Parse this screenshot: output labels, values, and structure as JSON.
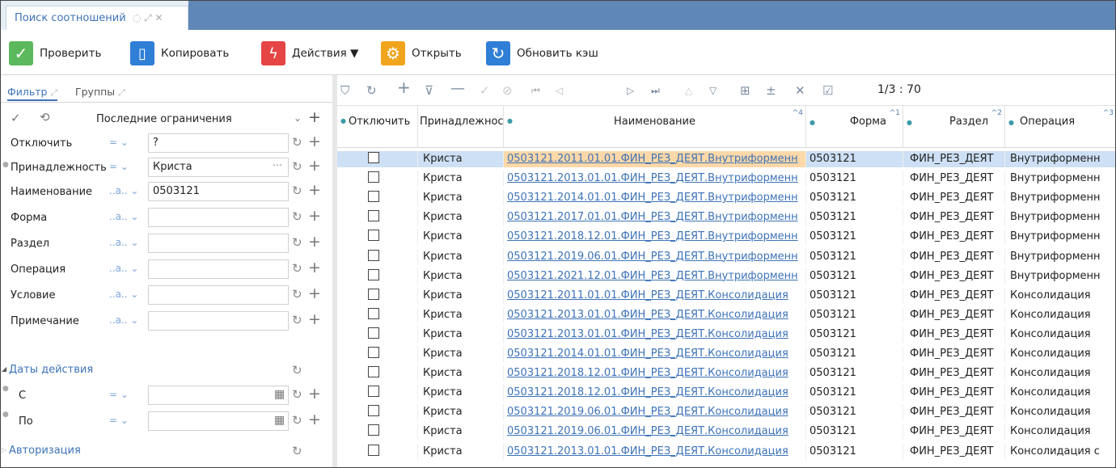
{
  "window": {
    "tab_title": "Поиск соотношений"
  },
  "toolbar": {
    "check_label": "Проверить",
    "copy_label": "Копировать",
    "actions_label": "Действия ▼",
    "open_label": "Открыть",
    "refresh_cache_label": "Обновить кэш"
  },
  "filter_panel": {
    "tab_filter": "Фильтр",
    "tab_groups": "Группы",
    "preset_value": "Последние ограничения",
    "fields": [
      {
        "label": "Отключить",
        "operator": "= ⌄",
        "value": "?"
      },
      {
        "label": "Принадлежность",
        "operator": "= ⌄",
        "value": "Криста"
      },
      {
        "label": "Наименование",
        "operator": "..a.. ⌄",
        "value": "0503121"
      },
      {
        "label": "Форма",
        "operator": "..a.. ⌄",
        "value": ""
      },
      {
        "label": "Раздел",
        "operator": "..a.. ⌄",
        "value": ""
      },
      {
        "label": "Операция",
        "operator": "..a.. ⌄",
        "value": ""
      },
      {
        "label": "Условие",
        "operator": "..a.. ⌄",
        "value": ""
      },
      {
        "label": "Примечание",
        "operator": "..a.. ⌄",
        "value": ""
      }
    ],
    "dates_section": "Даты действия",
    "date_from_label": "С",
    "date_to_label": "По",
    "date_operator": "= ⌄",
    "auth_section": "Авторизация"
  },
  "grid": {
    "pager": "1/3 : 70",
    "columns": [
      "Отключить",
      "Принадлежность",
      "Наименование",
      "Форма",
      "Раздел",
      "Операция"
    ],
    "rows": [
      {
        "owner": "Криста",
        "name": "0503121.2011.01.01.ФИН_РЕЗ_ДЕЯТ.Внутриформенн",
        "form": "0503121",
        "section": "ФИН_РЕЗ_ДЕЯТ",
        "operation": "Внутриформенн"
      },
      {
        "owner": "Криста",
        "name": "0503121.2013.01.01.ФИН_РЕЗ_ДЕЯТ.Внутриформенн",
        "form": "0503121",
        "section": "ФИН_РЕЗ_ДЕЯТ",
        "operation": "Внутриформенн"
      },
      {
        "owner": "Криста",
        "name": "0503121.2014.01.01.ФИН_РЕЗ_ДЕЯТ.Внутриформенн",
        "form": "0503121",
        "section": "ФИН_РЕЗ_ДЕЯТ",
        "operation": "Внутриформенн"
      },
      {
        "owner": "Криста",
        "name": "0503121.2017.01.01.ФИН_РЕЗ_ДЕЯТ.Внутриформенн",
        "form": "0503121",
        "section": "ФИН_РЕЗ_ДЕЯТ",
        "operation": "Внутриформенн"
      },
      {
        "owner": "Криста",
        "name": "0503121.2018.12.01.ФИН_РЕЗ_ДЕЯТ.Внутриформенн",
        "form": "0503121",
        "section": "ФИН_РЕЗ_ДЕЯТ",
        "operation": "Внутриформенн"
      },
      {
        "owner": "Криста",
        "name": "0503121.2019.06.01.ФИН_РЕЗ_ДЕЯТ.Внутриформенн",
        "form": "0503121",
        "section": "ФИН_РЕЗ_ДЕЯТ",
        "operation": "Внутриформенн"
      },
      {
        "owner": "Криста",
        "name": "0503121.2021.12.01.ФИН_РЕЗ_ДЕЯТ.Внутриформенн",
        "form": "0503121",
        "section": "ФИН_РЕЗ_ДЕЯТ",
        "operation": "Внутриформенн"
      },
      {
        "owner": "Криста",
        "name": "0503121.2011.01.01.ФИН_РЕЗ_ДЕЯТ.Консолидация",
        "form": "0503121",
        "section": "ФИН_РЕЗ_ДЕЯТ",
        "operation": "Консолидация"
      },
      {
        "owner": "Криста",
        "name": "0503121.2013.01.01.ФИН_РЕЗ_ДЕЯТ.Консолидация",
        "form": "0503121",
        "section": "ФИН_РЕЗ_ДЕЯТ",
        "operation": "Консолидация"
      },
      {
        "owner": "Криста",
        "name": "0503121.2013.01.01.ФИН_РЕЗ_ДЕЯТ.Консолидация",
        "form": "0503121",
        "section": "ФИН_РЕЗ_ДЕЯТ",
        "operation": "Консолидация"
      },
      {
        "owner": "Криста",
        "name": "0503121.2014.01.01.ФИН_РЕЗ_ДЕЯТ.Консолидация",
        "form": "0503121",
        "section": "ФИН_РЕЗ_ДЕЯТ",
        "operation": "Консолидация"
      },
      {
        "owner": "Криста",
        "name": "0503121.2018.12.01.ФИН_РЕЗ_ДЕЯТ.Консолидация",
        "form": "0503121",
        "section": "ФИН_РЕЗ_ДЕЯТ",
        "operation": "Консолидация"
      },
      {
        "owner": "Криста",
        "name": "0503121.2018.12.01.ФИН_РЕЗ_ДЕЯТ.Консолидация",
        "form": "0503121",
        "section": "ФИН_РЕЗ_ДЕЯТ",
        "operation": "Консолидация"
      },
      {
        "owner": "Криста",
        "name": "0503121.2019.06.01.ФИН_РЕЗ_ДЕЯТ.Консолидация",
        "form": "0503121",
        "section": "ФИН_РЕЗ_ДЕЯТ",
        "operation": "Консолидация"
      },
      {
        "owner": "Криста",
        "name": "0503121.2019.06.01.ФИН_РЕЗ_ДЕЯТ.Консолидация",
        "form": "0503121",
        "section": "ФИН_РЕЗ_ДЕЯТ",
        "operation": "Консолидация"
      },
      {
        "owner": "Криста",
        "name": "0503121.2013.01.01.ФИН_РЕЗ_ДЕЯТ.Консолидация",
        "form": "0503121",
        "section": "ФИН_РЕЗ_ДЕЯТ",
        "operation": "Консолидация с"
      }
    ]
  },
  "colors": {
    "accent": "#3d73b8",
    "tab_strip": "#5f88b8",
    "selected_row": "#cde0f5",
    "selected_cell": "#fdd8a8"
  }
}
